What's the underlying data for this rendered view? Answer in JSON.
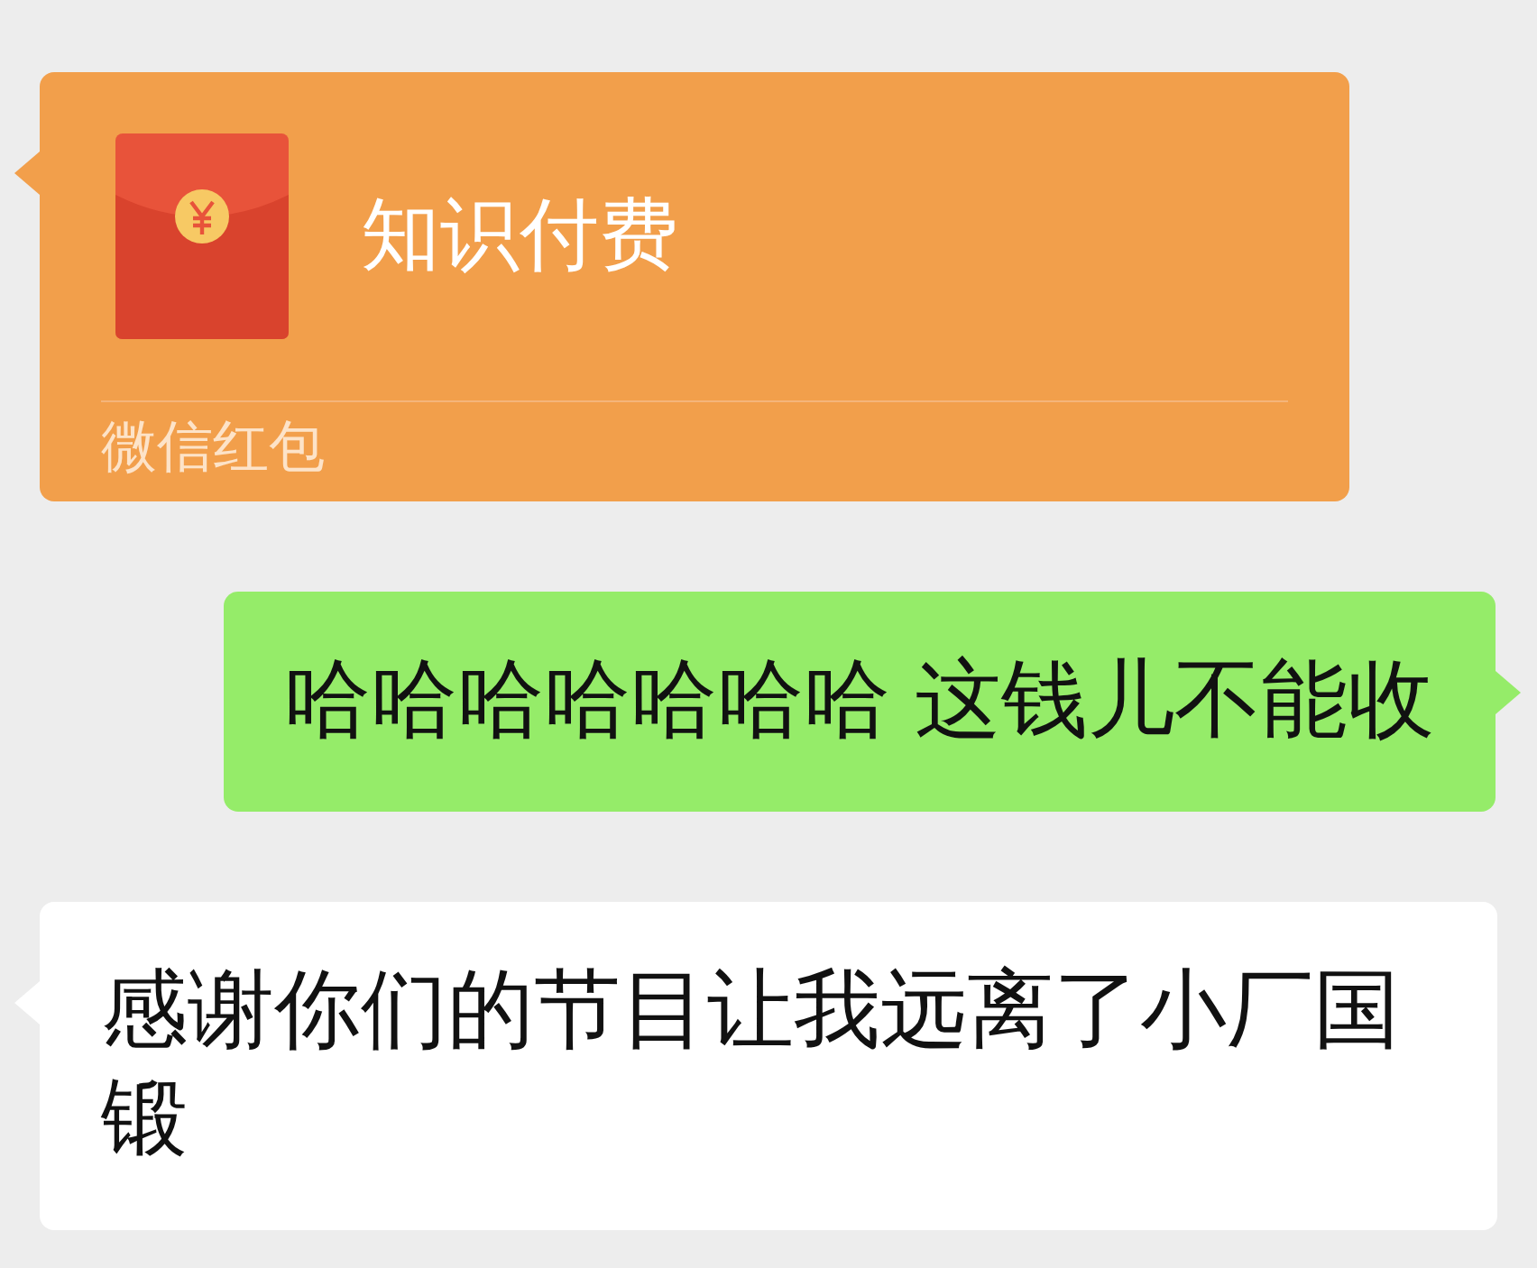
{
  "messages": [
    {
      "kind": "gift_packet",
      "outgoing": false,
      "title": "知识付费",
      "footer": "微信红包"
    },
    {
      "kind": "text",
      "outgoing": true,
      "text": "哈哈哈哈哈哈哈 这钱儿不能收"
    },
    {
      "kind": "text",
      "outgoing": false,
      "text": "感谢你们的节目让我远离了小厂国锻"
    }
  ]
}
